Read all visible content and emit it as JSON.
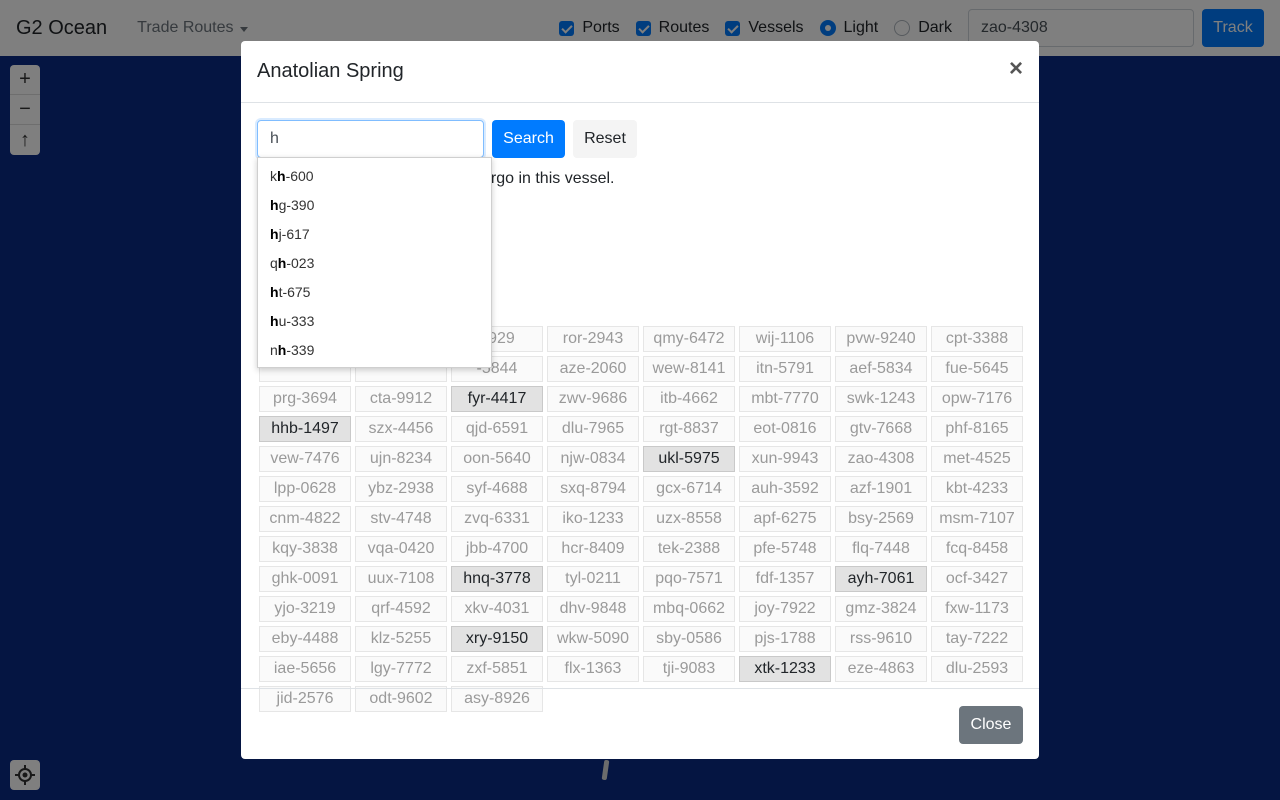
{
  "navbar": {
    "brand": "G2 Ocean",
    "trade_routes_label": "Trade Routes",
    "options": [
      {
        "label": "Ports",
        "type": "checkbox",
        "checked": true
      },
      {
        "label": "Routes",
        "type": "checkbox",
        "checked": true
      },
      {
        "label": "Vessels",
        "type": "checkbox",
        "checked": true
      },
      {
        "label": "Light",
        "type": "radio",
        "checked": true
      },
      {
        "label": "Dark",
        "type": "radio",
        "checked": false
      }
    ],
    "track_value": "zao-4308",
    "track_label": "Track"
  },
  "map": {
    "zoom_in": "+",
    "zoom_out": "−",
    "compass": "↑"
  },
  "modal": {
    "title": "Anatolian Spring",
    "close_symbol": "×",
    "search_value": "h",
    "search_label": "Search",
    "reset_label": "Reset",
    "help_text_visible": "heir cargo in this vessel.",
    "autocomplete": [
      {
        "pre": "k",
        "match": "h",
        "post": "-600"
      },
      {
        "pre": "",
        "match": "h",
        "post": "g-390"
      },
      {
        "pre": "",
        "match": "h",
        "post": "j-617"
      },
      {
        "pre": "q",
        "match": "h",
        "post": "-023"
      },
      {
        "pre": "",
        "match": "h",
        "post": "t-675"
      },
      {
        "pre": "",
        "match": "h",
        "post": "u-333"
      },
      {
        "pre": "n",
        "match": "h",
        "post": "-339"
      }
    ],
    "cargo_chips": [
      {
        "label": "",
        "hl": false
      },
      {
        "label": "",
        "hl": false
      },
      {
        "label": "0929",
        "hl": false
      },
      {
        "label": "ror-2943",
        "hl": false
      },
      {
        "label": "qmy-6472",
        "hl": false
      },
      {
        "label": "wij-1106",
        "hl": false
      },
      {
        "label": "pvw-9240",
        "hl": false
      },
      {
        "label": "cpt-3388",
        "hl": false
      },
      {
        "label": "",
        "hl": false
      },
      {
        "label": "",
        "hl": false
      },
      {
        "label": "-5844",
        "hl": false
      },
      {
        "label": "aze-2060",
        "hl": false
      },
      {
        "label": "wew-8141",
        "hl": false
      },
      {
        "label": "itn-5791",
        "hl": false
      },
      {
        "label": "aef-5834",
        "hl": false
      },
      {
        "label": "fue-5645",
        "hl": false
      },
      {
        "label": "prg-3694",
        "hl": false
      },
      {
        "label": "cta-9912",
        "hl": false
      },
      {
        "label": "fyr-4417",
        "hl": true
      },
      {
        "label": "zwv-9686",
        "hl": false
      },
      {
        "label": "itb-4662",
        "hl": false
      },
      {
        "label": "mbt-7770",
        "hl": false
      },
      {
        "label": "swk-1243",
        "hl": false
      },
      {
        "label": "opw-7176",
        "hl": false
      },
      {
        "label": "hhb-1497",
        "hl": true
      },
      {
        "label": "szx-4456",
        "hl": false
      },
      {
        "label": "qjd-6591",
        "hl": false
      },
      {
        "label": "dlu-7965",
        "hl": false
      },
      {
        "label": "rgt-8837",
        "hl": false
      },
      {
        "label": "eot-0816",
        "hl": false
      },
      {
        "label": "gtv-7668",
        "hl": false
      },
      {
        "label": "phf-8165",
        "hl": false
      },
      {
        "label": "vew-7476",
        "hl": false
      },
      {
        "label": "ujn-8234",
        "hl": false
      },
      {
        "label": "oon-5640",
        "hl": false
      },
      {
        "label": "njw-0834",
        "hl": false
      },
      {
        "label": "ukl-5975",
        "hl": true
      },
      {
        "label": "xun-9943",
        "hl": false
      },
      {
        "label": "zao-4308",
        "hl": false
      },
      {
        "label": "met-4525",
        "hl": false
      },
      {
        "label": "lpp-0628",
        "hl": false
      },
      {
        "label": "ybz-2938",
        "hl": false
      },
      {
        "label": "syf-4688",
        "hl": false
      },
      {
        "label": "sxq-8794",
        "hl": false
      },
      {
        "label": "gcx-6714",
        "hl": false
      },
      {
        "label": "auh-3592",
        "hl": false
      },
      {
        "label": "azf-1901",
        "hl": false
      },
      {
        "label": "kbt-4233",
        "hl": false
      },
      {
        "label": "cnm-4822",
        "hl": false
      },
      {
        "label": "stv-4748",
        "hl": false
      },
      {
        "label": "zvq-6331",
        "hl": false
      },
      {
        "label": "iko-1233",
        "hl": false
      },
      {
        "label": "uzx-8558",
        "hl": false
      },
      {
        "label": "apf-6275",
        "hl": false
      },
      {
        "label": "bsy-2569",
        "hl": false
      },
      {
        "label": "msm-7107",
        "hl": false
      },
      {
        "label": "kqy-3838",
        "hl": false
      },
      {
        "label": "vqa-0420",
        "hl": false
      },
      {
        "label": "jbb-4700",
        "hl": false
      },
      {
        "label": "hcr-8409",
        "hl": false
      },
      {
        "label": "tek-2388",
        "hl": false
      },
      {
        "label": "pfe-5748",
        "hl": false
      },
      {
        "label": "flq-7448",
        "hl": false
      },
      {
        "label": "fcq-8458",
        "hl": false
      },
      {
        "label": "ghk-0091",
        "hl": false
      },
      {
        "label": "uux-7108",
        "hl": false
      },
      {
        "label": "hnq-3778",
        "hl": true
      },
      {
        "label": "tyl-0211",
        "hl": false
      },
      {
        "label": "pqo-7571",
        "hl": false
      },
      {
        "label": "fdf-1357",
        "hl": false
      },
      {
        "label": "ayh-7061",
        "hl": true
      },
      {
        "label": "ocf-3427",
        "hl": false
      },
      {
        "label": "yjo-3219",
        "hl": false
      },
      {
        "label": "qrf-4592",
        "hl": false
      },
      {
        "label": "xkv-4031",
        "hl": false
      },
      {
        "label": "dhv-9848",
        "hl": false
      },
      {
        "label": "mbq-0662",
        "hl": false
      },
      {
        "label": "joy-7922",
        "hl": false
      },
      {
        "label": "gmz-3824",
        "hl": false
      },
      {
        "label": "fxw-1173",
        "hl": false
      },
      {
        "label": "eby-4488",
        "hl": false
      },
      {
        "label": "klz-5255",
        "hl": false
      },
      {
        "label": "xry-9150",
        "hl": true
      },
      {
        "label": "wkw-5090",
        "hl": false
      },
      {
        "label": "sby-0586",
        "hl": false
      },
      {
        "label": "pjs-1788",
        "hl": false
      },
      {
        "label": "rss-9610",
        "hl": false
      },
      {
        "label": "tay-7222",
        "hl": false
      },
      {
        "label": "iae-5656",
        "hl": false
      },
      {
        "label": "lgy-7772",
        "hl": false
      },
      {
        "label": "zxf-5851",
        "hl": false
      },
      {
        "label": "flx-1363",
        "hl": false
      },
      {
        "label": "tji-9083",
        "hl": false
      },
      {
        "label": "xtk-1233",
        "hl": true
      },
      {
        "label": "eze-4863",
        "hl": false
      },
      {
        "label": "dlu-2593",
        "hl": false
      },
      {
        "label": "jid-2576",
        "hl": false
      },
      {
        "label": "odt-9602",
        "hl": false
      },
      {
        "label": "asy-8926",
        "hl": false
      }
    ],
    "close_label": "Close"
  },
  "colors": {
    "map_bg": "#0b2a85",
    "primary": "#007bff",
    "secondary": "#6c757d"
  }
}
